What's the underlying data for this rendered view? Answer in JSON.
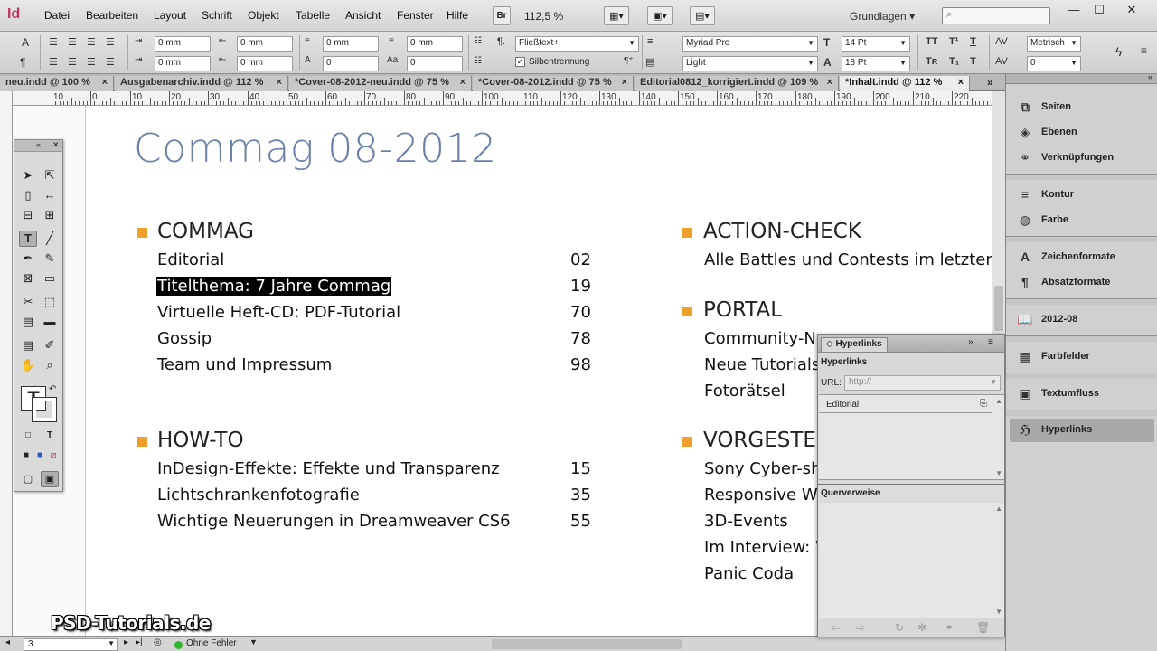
{
  "app": {
    "logo": "Id",
    "zoom": "112,5 %",
    "bridge": "Br",
    "workspace": "Grundlagen"
  },
  "menu": [
    "Datei",
    "Bearbeiten",
    "Layout",
    "Schrift",
    "Objekt",
    "Tabelle",
    "Ansicht",
    "Fenster",
    "Hilfe"
  ],
  "window": {
    "minimize": "—",
    "maximize": "☐",
    "close": "✕"
  },
  "control": {
    "indent_left": "0 mm",
    "indent_right": "0 mm",
    "indent_first": "0 mm",
    "indent_last": "0 mm",
    "space_before": "0 mm",
    "space_after": "0 mm",
    "dropcap_lines": "0",
    "dropcap_chars": "0",
    "paragraph_style": "Fließtext+",
    "hyphenation_label": "Silbentrennung",
    "font_family": "Myriad Pro",
    "font_style": "Light",
    "font_size": "14 Pt",
    "leading": "18 Pt",
    "kerning": "Metrisch",
    "tracking": "0"
  },
  "tabs": [
    {
      "label": "neu.indd @ 100 %"
    },
    {
      "label": "Ausgabenarchiv.indd @ 112 %"
    },
    {
      "label": "*Cover-08-2012-neu.indd @ 75 %"
    },
    {
      "label": "*Cover-08-2012.indd @ 75 %"
    },
    {
      "label": "Editorial0812_korrigiert.indd @ 109 %"
    },
    {
      "label": "*Inhalt.indd @ 112 %"
    }
  ],
  "tab_close": "×",
  "ruler": [
    "10",
    "0",
    "10",
    "20",
    "30",
    "40",
    "50",
    "60",
    "70",
    "80",
    "90",
    "100",
    "110",
    "120",
    "130",
    "140",
    "150",
    "160",
    "170",
    "180",
    "190",
    "200",
    "210",
    "220",
    "230"
  ],
  "document": {
    "title": "Commag 08-2012",
    "sections_left": [
      {
        "heading": "COMMAG",
        "entries": [
          {
            "text": "Editorial",
            "page": "02"
          },
          {
            "text": "Titelthema: 7 Jahre Commag",
            "page": "19"
          },
          {
            "text": "Virtuelle Heft-CD: PDF-Tutorial",
            "page": "70"
          },
          {
            "text": "Gossip",
            "page": "78"
          },
          {
            "text": "Team und Impressum",
            "page": "98"
          }
        ]
      },
      {
        "heading": "HOW-TO",
        "entries": [
          {
            "text": "InDesign-Effekte: Effekte und Transparenz",
            "page": "15"
          },
          {
            "text": "Lichtschrankenfotografie",
            "page": "35"
          },
          {
            "text": "Wichtige Neuerungen in Dreamweaver CS6",
            "page": "55"
          }
        ]
      }
    ],
    "sections_right": [
      {
        "heading": "ACTION-CHECK",
        "entries": [
          "Alle Battles und Contests im letzten M"
        ]
      },
      {
        "heading": "PORTAL",
        "entries": [
          "Community-Ne",
          "Neue Tutorials",
          "Fotorätsel"
        ]
      },
      {
        "heading": "VORGESTEL",
        "entries": [
          "Sony Cyber-sho",
          "Responsive We",
          "3D-Events",
          "Im Interview: W",
          "Panic Coda"
        ]
      }
    ]
  },
  "status": {
    "page": "3",
    "errors": "Ohne Fehler"
  },
  "hyperlinks_panel": {
    "tab": "Hyperlinks",
    "section_title": "Hyperlinks",
    "url_label": "URL:",
    "url_placeholder": "http://",
    "items": [
      "Editorial"
    ],
    "xref_title": "Querverweise"
  },
  "dock": [
    {
      "label": "Seiten",
      "icon": "pages-icon"
    },
    {
      "label": "Ebenen",
      "icon": "layers-icon"
    },
    {
      "label": "Verknüpfungen",
      "icon": "links-icon"
    },
    {
      "label": "Kontur",
      "icon": "stroke-icon"
    },
    {
      "label": "Farbe",
      "icon": "color-icon"
    },
    {
      "label": "Zeichenformate",
      "icon": "character-styles-icon"
    },
    {
      "label": "Absatzformate",
      "icon": "paragraph-styles-icon"
    },
    {
      "label": "2012-08",
      "icon": "library-icon"
    },
    {
      "label": "Farbfelder",
      "icon": "swatches-icon"
    },
    {
      "label": "Textumfluss",
      "icon": "text-wrap-icon"
    },
    {
      "label": "Hyperlinks",
      "icon": "hyperlinks-icon"
    }
  ],
  "watermark": "PSD-Tutorials.de",
  "colors": {
    "title": "#6a7fa8",
    "bullet": "#f0a02a",
    "selection": "#000000",
    "app_logo": "#c0355b"
  }
}
